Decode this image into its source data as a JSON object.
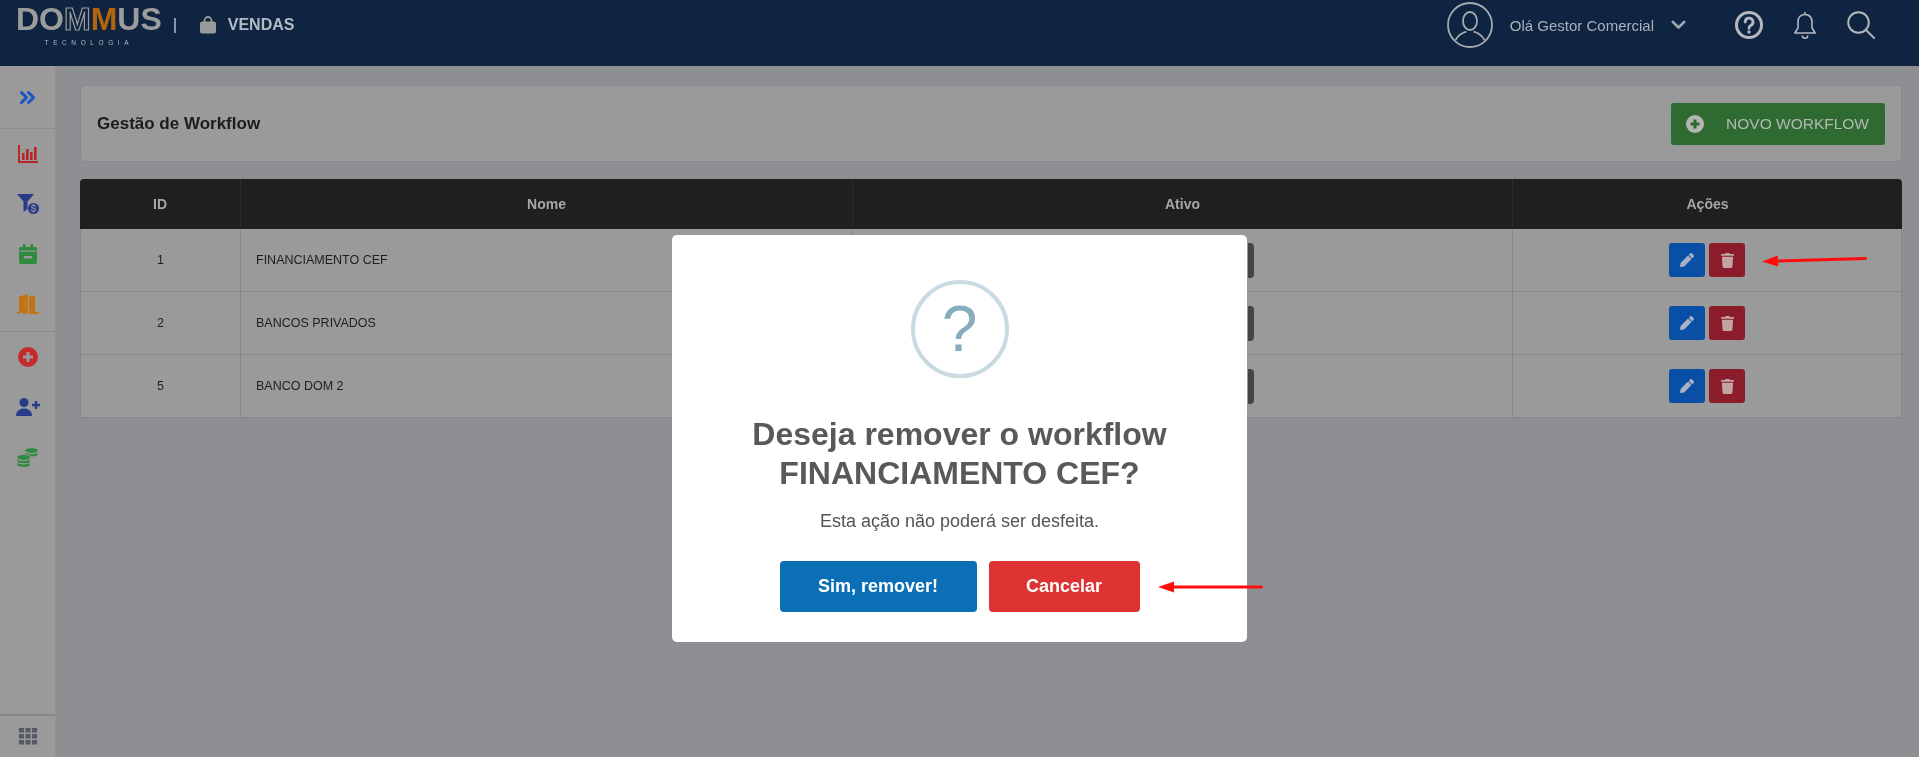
{
  "header": {
    "logo": {
      "wordmark": "DOMMUS",
      "tagline": "TECNOLOGIA"
    },
    "module": {
      "label": "VENDAS"
    },
    "user": {
      "greeting": "Olá Gestor Comercial"
    }
  },
  "sidebar": {
    "groups": [
      {
        "items": [
          {
            "kind": "expand"
          }
        ]
      },
      {
        "items": [
          {
            "kind": "chart"
          },
          {
            "kind": "funnel"
          },
          {
            "kind": "calendar"
          },
          {
            "kind": "door"
          }
        ]
      },
      {
        "items": [
          {
            "kind": "add"
          },
          {
            "kind": "add_user"
          },
          {
            "kind": "coins"
          }
        ]
      }
    ],
    "footer": {
      "kind": "apps"
    }
  },
  "page": {
    "title": "Gestão de Workflow",
    "new_button": {
      "label": "NOVO WORKFLOW"
    }
  },
  "table": {
    "columns": [
      "ID",
      "Nome",
      "Ativo",
      "Ações"
    ],
    "rows": [
      {
        "id": "1",
        "name": "FINANCIAMENTO CEF",
        "marked": true
      },
      {
        "id": "2",
        "name": "BANCOS PRIVADOS",
        "marked": false
      },
      {
        "id": "5",
        "name": "BANCO DOM 2",
        "marked": false
      }
    ]
  },
  "modal": {
    "icon": "?",
    "title": "Deseja remover o workflow FINANCIAMENTO CEF?",
    "message": "Esta ação não poderá ser desfeita.",
    "confirm": {
      "label": "Sim, remover!",
      "marked": false
    },
    "cancel": {
      "label": "Cancelar",
      "marked": true
    }
  }
}
